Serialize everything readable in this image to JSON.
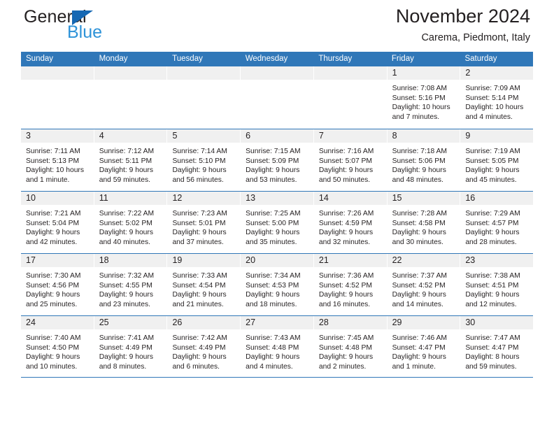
{
  "brand": {
    "name_part1": "General",
    "name_part2": "Blue",
    "triangle_color": "#1668b3",
    "blue_text_color": "#2e93d8"
  },
  "header": {
    "title": "November 2024",
    "subtitle": "Carema, Piedmont, Italy"
  },
  "theme": {
    "header_blue": "#3077b8",
    "daynum_band_gray": "#f0f0f0",
    "text_color": "#231f20"
  },
  "weekdays": [
    "Sunday",
    "Monday",
    "Tuesday",
    "Wednesday",
    "Thursday",
    "Friday",
    "Saturday"
  ],
  "weeks": [
    [
      {
        "day": "",
        "lines": []
      },
      {
        "day": "",
        "lines": []
      },
      {
        "day": "",
        "lines": []
      },
      {
        "day": "",
        "lines": []
      },
      {
        "day": "",
        "lines": []
      },
      {
        "day": "1",
        "lines": [
          "Sunrise: 7:08 AM",
          "Sunset: 5:16 PM",
          "Daylight: 10 hours",
          "and 7 minutes."
        ]
      },
      {
        "day": "2",
        "lines": [
          "Sunrise: 7:09 AM",
          "Sunset: 5:14 PM",
          "Daylight: 10 hours",
          "and 4 minutes."
        ]
      }
    ],
    [
      {
        "day": "3",
        "lines": [
          "Sunrise: 7:11 AM",
          "Sunset: 5:13 PM",
          "Daylight: 10 hours",
          "and 1 minute."
        ]
      },
      {
        "day": "4",
        "lines": [
          "Sunrise: 7:12 AM",
          "Sunset: 5:11 PM",
          "Daylight: 9 hours",
          "and 59 minutes."
        ]
      },
      {
        "day": "5",
        "lines": [
          "Sunrise: 7:14 AM",
          "Sunset: 5:10 PM",
          "Daylight: 9 hours",
          "and 56 minutes."
        ]
      },
      {
        "day": "6",
        "lines": [
          "Sunrise: 7:15 AM",
          "Sunset: 5:09 PM",
          "Daylight: 9 hours",
          "and 53 minutes."
        ]
      },
      {
        "day": "7",
        "lines": [
          "Sunrise: 7:16 AM",
          "Sunset: 5:07 PM",
          "Daylight: 9 hours",
          "and 50 minutes."
        ]
      },
      {
        "day": "8",
        "lines": [
          "Sunrise: 7:18 AM",
          "Sunset: 5:06 PM",
          "Daylight: 9 hours",
          "and 48 minutes."
        ]
      },
      {
        "day": "9",
        "lines": [
          "Sunrise: 7:19 AM",
          "Sunset: 5:05 PM",
          "Daylight: 9 hours",
          "and 45 minutes."
        ]
      }
    ],
    [
      {
        "day": "10",
        "lines": [
          "Sunrise: 7:21 AM",
          "Sunset: 5:04 PM",
          "Daylight: 9 hours",
          "and 42 minutes."
        ]
      },
      {
        "day": "11",
        "lines": [
          "Sunrise: 7:22 AM",
          "Sunset: 5:02 PM",
          "Daylight: 9 hours",
          "and 40 minutes."
        ]
      },
      {
        "day": "12",
        "lines": [
          "Sunrise: 7:23 AM",
          "Sunset: 5:01 PM",
          "Daylight: 9 hours",
          "and 37 minutes."
        ]
      },
      {
        "day": "13",
        "lines": [
          "Sunrise: 7:25 AM",
          "Sunset: 5:00 PM",
          "Daylight: 9 hours",
          "and 35 minutes."
        ]
      },
      {
        "day": "14",
        "lines": [
          "Sunrise: 7:26 AM",
          "Sunset: 4:59 PM",
          "Daylight: 9 hours",
          "and 32 minutes."
        ]
      },
      {
        "day": "15",
        "lines": [
          "Sunrise: 7:28 AM",
          "Sunset: 4:58 PM",
          "Daylight: 9 hours",
          "and 30 minutes."
        ]
      },
      {
        "day": "16",
        "lines": [
          "Sunrise: 7:29 AM",
          "Sunset: 4:57 PM",
          "Daylight: 9 hours",
          "and 28 minutes."
        ]
      }
    ],
    [
      {
        "day": "17",
        "lines": [
          "Sunrise: 7:30 AM",
          "Sunset: 4:56 PM",
          "Daylight: 9 hours",
          "and 25 minutes."
        ]
      },
      {
        "day": "18",
        "lines": [
          "Sunrise: 7:32 AM",
          "Sunset: 4:55 PM",
          "Daylight: 9 hours",
          "and 23 minutes."
        ]
      },
      {
        "day": "19",
        "lines": [
          "Sunrise: 7:33 AM",
          "Sunset: 4:54 PM",
          "Daylight: 9 hours",
          "and 21 minutes."
        ]
      },
      {
        "day": "20",
        "lines": [
          "Sunrise: 7:34 AM",
          "Sunset: 4:53 PM",
          "Daylight: 9 hours",
          "and 18 minutes."
        ]
      },
      {
        "day": "21",
        "lines": [
          "Sunrise: 7:36 AM",
          "Sunset: 4:52 PM",
          "Daylight: 9 hours",
          "and 16 minutes."
        ]
      },
      {
        "day": "22",
        "lines": [
          "Sunrise: 7:37 AM",
          "Sunset: 4:52 PM",
          "Daylight: 9 hours",
          "and 14 minutes."
        ]
      },
      {
        "day": "23",
        "lines": [
          "Sunrise: 7:38 AM",
          "Sunset: 4:51 PM",
          "Daylight: 9 hours",
          "and 12 minutes."
        ]
      }
    ],
    [
      {
        "day": "24",
        "lines": [
          "Sunrise: 7:40 AM",
          "Sunset: 4:50 PM",
          "Daylight: 9 hours",
          "and 10 minutes."
        ]
      },
      {
        "day": "25",
        "lines": [
          "Sunrise: 7:41 AM",
          "Sunset: 4:49 PM",
          "Daylight: 9 hours",
          "and 8 minutes."
        ]
      },
      {
        "day": "26",
        "lines": [
          "Sunrise: 7:42 AM",
          "Sunset: 4:49 PM",
          "Daylight: 9 hours",
          "and 6 minutes."
        ]
      },
      {
        "day": "27",
        "lines": [
          "Sunrise: 7:43 AM",
          "Sunset: 4:48 PM",
          "Daylight: 9 hours",
          "and 4 minutes."
        ]
      },
      {
        "day": "28",
        "lines": [
          "Sunrise: 7:45 AM",
          "Sunset: 4:48 PM",
          "Daylight: 9 hours",
          "and 2 minutes."
        ]
      },
      {
        "day": "29",
        "lines": [
          "Sunrise: 7:46 AM",
          "Sunset: 4:47 PM",
          "Daylight: 9 hours",
          "and 1 minute."
        ]
      },
      {
        "day": "30",
        "lines": [
          "Sunrise: 7:47 AM",
          "Sunset: 4:47 PM",
          "Daylight: 8 hours",
          "and 59 minutes."
        ]
      }
    ]
  ]
}
